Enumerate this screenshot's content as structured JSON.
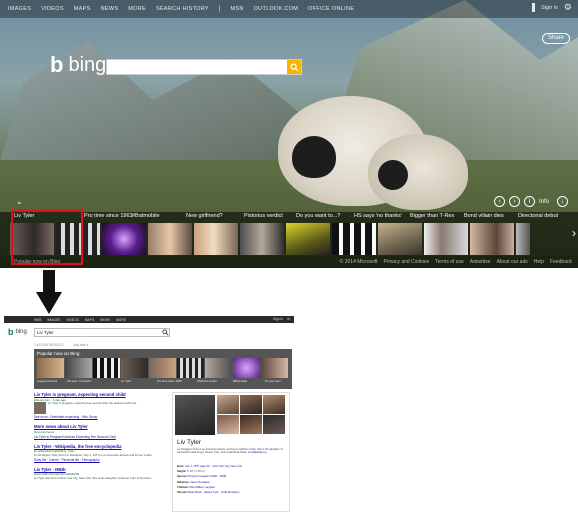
{
  "hero": {
    "nav": [
      "IMAGES",
      "VIDEOS",
      "MAPS",
      "NEWS",
      "MORE",
      "SEARCH HISTORY",
      "MSN",
      "OUTLOOK.COM",
      "OFFICE ONLINE"
    ],
    "nav_separator": "|",
    "sign_in": "Sign in",
    "share_label": "Share",
    "logo_text": "bing",
    "search_value": "",
    "info_label": "Info",
    "carousel_captions": [
      "Liv Tyler",
      "Pro time since 1963",
      "#Batmobile",
      "New girlfriend?",
      "Pistorius verdict",
      "Do you want to...?",
      "HS says 'no thanks'",
      "Bigger than T-Rex",
      "Bond villain dies",
      "Directorial debut"
    ],
    "footer_left": "Popular now on Bing",
    "footer_links": [
      "© 2014 Microsoft",
      "Privacy and Cookies",
      "Terms of use",
      "Advertise",
      "About our ads",
      "Help",
      "Feedback"
    ]
  },
  "results": {
    "nav": [
      "WEB",
      "IMAGES",
      "VIDEOS",
      "MAPS",
      "NEWS",
      "MORE"
    ],
    "sign_in": "Sign in",
    "logo_text": "bing",
    "query": "Liv Tyler",
    "result_count": "1,400,000 RESULTS",
    "any_time": "Any time ▾",
    "popular_header": "Popular now on Bing",
    "popular_labels": [
      "Legend of Korra",
      "HS says 'no thanks'",
      "Liv Tyler",
      "Pro time since 1963",
      "Pistorius verdict",
      "#Batmobile",
      "Do you want"
    ],
    "items": [
      {
        "title": "Liv Tyler is pregnant, expecting second child",
        "url": "ENews.com · 1 day ago",
        "text": "Liv Tyler is pregnant, expecting her second child, the actress confirmed.",
        "sub": "See more: Celebrities expecting · Milo Gump"
      },
      {
        "title": "More news about Liv Tyler",
        "url": "bing.com/news",
        "text": "",
        "sub": "Liv Tyler is Pregnant! Actress Expecting Her Second Child"
      },
      {
        "title": "Liv Tyler - Wikipedia, the free encyclopedia",
        "url": "en.wikipedia.org/wiki/Liv_Tyler",
        "text": "Liv Rundgren Tyler (born Liv Rundgren; July 1, 1977) is an American actress and former model.",
        "sub": "Early life · Career · Personal life · Filmography"
      },
      {
        "title": "Liv Tyler - IMDb",
        "url": "www.imdb.com/name/nm0000239",
        "text": "Liv Tyler was born in New York City, New York. She is the daughter of Steven Tyler of the band.",
        "sub": ""
      }
    ],
    "panel": {
      "name": "Liv Tyler",
      "description": "Liv Rundgren Tyler is an American actress and former fashion model. She is the daughter of Aerosmith's lead singer, Steven Tyler, and model Bebe Buell.",
      "source": "en.wikipedia.org",
      "facts": [
        {
          "k": "Born:",
          "v": "July 1, 1977 (age 37) · New York City, New York"
        },
        {
          "k": "Height:",
          "v": "5' 10\" (1.78 m)"
        },
        {
          "k": "Spouse:",
          "v": "Royston Langdon (1996 - 2008)"
        },
        {
          "k": "Relatives:",
          "v": "Jason Rundgren"
        },
        {
          "k": "Children:",
          "v": "Milo William Langdon"
        },
        {
          "k": "Parents:",
          "v": "Bebe Buell · Steven Tyler · Todd Rundgren"
        }
      ]
    }
  },
  "colors": {
    "search_accent": "#f7b500",
    "highlight": "#e0101f",
    "link": "#1a0dab",
    "url_green": "#006d21"
  }
}
